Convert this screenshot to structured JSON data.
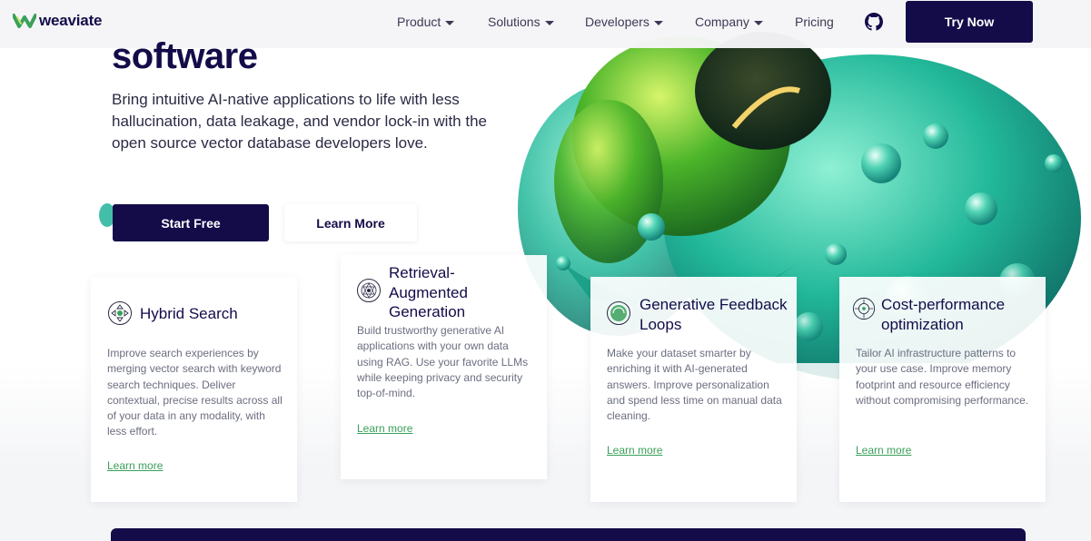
{
  "brand": {
    "name": "weaviate",
    "colors": {
      "navy": "#130c49",
      "green": "#3aa05a",
      "teal": "#2fc7a4"
    }
  },
  "nav": {
    "items": [
      {
        "label": "Product",
        "dropdown": true
      },
      {
        "label": "Solutions",
        "dropdown": true
      },
      {
        "label": "Developers",
        "dropdown": true
      },
      {
        "label": "Company",
        "dropdown": true
      },
      {
        "label": "Pricing",
        "dropdown": false
      }
    ],
    "github_icon": "github-icon",
    "cta_label": "Try Now"
  },
  "hero": {
    "heading": "software",
    "subtitle": "Bring intuitive AI-native applications to life with less hallucination, data leakage, and vendor lock-in with the open source vector database developers love.",
    "primary_button": "Start Free",
    "secondary_button": "Learn More"
  },
  "features": [
    {
      "icon": "hybrid-search-icon",
      "title": "Hybrid Search",
      "text": "Improve search experiences by merging vector search with keyword search techniques. Deliver contextual, precise results across all of your data in any modality, with less effort.",
      "link": "Learn more"
    },
    {
      "icon": "rag-icon",
      "title": "Retrieval-Augmented Generation",
      "text": "Build trustworthy generative AI applications with your own data using RAG. Use your favorite LLMs while keeping privacy and security top-of-mind.",
      "link": "Learn more"
    },
    {
      "icon": "feedback-loops-icon",
      "title": "Generative Feedback Loops",
      "text": "Make your dataset smarter by enriching it with AI-generated answers. Improve personalization and spend less time on manual data cleaning.",
      "link": "Learn more"
    },
    {
      "icon": "cost-performance-icon",
      "title": "Cost-performance optimization",
      "text": "Tailor AI infrastructure patterns to your use case. Improve memory footprint and resource efficiency without compromising performance.",
      "link": "Learn more"
    }
  ]
}
